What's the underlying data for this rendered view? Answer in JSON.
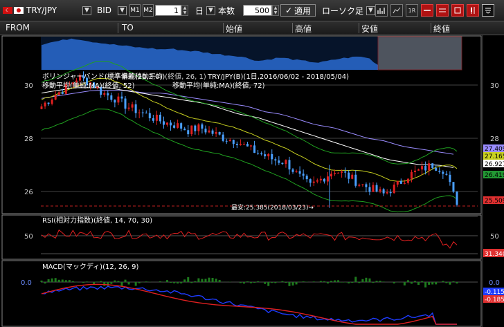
{
  "toolbar": {
    "pair": "TRY/JPY",
    "price_type": "BID",
    "period_value": "1",
    "period_unit": "日",
    "count_label": "本数",
    "count_value": "500",
    "apply_label": "適用",
    "candle_label": "ローソク足",
    "m1_label": "M1",
    "m2_label": "M2",
    "check_mark": "✓",
    "dropdown_arrow": "▼",
    "icons": [
      "bar-chart-icon",
      "line-chart-icon",
      "1r-icon",
      "red-line-icon",
      "red-band-icon",
      "red-chart-icon",
      "red-candle-icon",
      "menu-icon"
    ]
  },
  "header": {
    "columns": [
      "FROM",
      "TO",
      "始値",
      "高値",
      "安値",
      "終値"
    ]
  },
  "main": {
    "indicator_bb": "ボリンジャーバンド(標準偏差(20,2,0))",
    "overlay_label": "単純移動平均 (終値, 26, 1)",
    "title": "TRY/JPY(B)(1日,2016/06/02 - 2018/05/04)",
    "ma_labels": [
      "移動平均(単純:MA)(終値, 52)",
      "移動平均(単純:MA)(終値, 72)"
    ],
    "low_note": "最安:25.385(2018/03/23)→",
    "y_ticks": [
      "30",
      "28",
      "26"
    ],
    "right_ticks": [
      "30",
      "28",
      "26"
    ],
    "price_tags": [
      {
        "text": "27.409",
        "color": "#9a8cff"
      },
      {
        "text": "27.165",
        "color": "#c8d020"
      },
      {
        "text": "26.927",
        "color": "#ffffff"
      },
      {
        "text": "26.419",
        "color": "#229933"
      },
      {
        "text": "25.509",
        "color": "#e03030"
      }
    ]
  },
  "rsi": {
    "label": "RSI(相対力指数)(終値, 14, 70, 30)",
    "y_ticks": [
      "50"
    ],
    "right_ticks": [
      "50"
    ],
    "value_tag": "31.340"
  },
  "macd": {
    "label": "MACD(マックディ)(12, 26, 9)",
    "y_ticks": [
      "0.0"
    ],
    "right_ticks": [
      "0.0"
    ],
    "value_tags": [
      "-0.115",
      "-0.185"
    ]
  },
  "colors": {
    "up": "#e02020",
    "down": "#4aa0ff",
    "bb_band": "#20a020",
    "ma52": "#ffffff",
    "ma72": "#9a8cff",
    "ma26": "#c8d020",
    "rsi_line": "#e02020",
    "macd_line": "#1e3cff",
    "signal_line": "#e02020",
    "hist": "#1e7a1e"
  },
  "chart_data": {
    "type": "line",
    "title": "TRY/JPY(B)(1日,2016/06/02 - 2018/05/04)",
    "x_range": [
      "2016/06/02",
      "2018/05/04"
    ],
    "ylim": [
      25.2,
      30.6
    ],
    "yticks": [
      26,
      28,
      30
    ],
    "series": [
      {
        "name": "close",
        "values": [
          29.2,
          29.6,
          29.9,
          30.3,
          30.1,
          29.7,
          29.5,
          29.2,
          29.0,
          28.8,
          28.6,
          28.5,
          28.3,
          28.4,
          28.2,
          28.0,
          27.9,
          27.6,
          27.4,
          27.2,
          27.1,
          26.6,
          26.2,
          26.5,
          26.8,
          26.6,
          26.3,
          26.1,
          25.9,
          26.2,
          26.6,
          26.8,
          27.0,
          26.8,
          25.5
        ]
      },
      {
        "name": "移動平均(単純:MA)(終値, 52)",
        "values": [
          29.7,
          29.8,
          29.9,
          29.9,
          29.9,
          29.8,
          29.7,
          29.6,
          29.5,
          29.4,
          29.3,
          29.1,
          28.9,
          28.8,
          28.6,
          28.4,
          28.2,
          28.0,
          27.8,
          27.6,
          27.4,
          27.2,
          27.1,
          27.0,
          27.0,
          26.9
        ]
      },
      {
        "name": "移動平均(単純:MA)(終値, 72)",
        "values": [
          29.5,
          29.6,
          29.7,
          29.8,
          29.8,
          29.8,
          29.7,
          29.7,
          29.6,
          29.5,
          29.4,
          29.3,
          29.2,
          29.0,
          28.9,
          28.7,
          28.5,
          28.4,
          28.2,
          28.0,
          27.9,
          27.7,
          27.6,
          27.5,
          27.4
        ]
      },
      {
        "name": "最安",
        "values": [
          25.385
        ]
      }
    ],
    "rsi": {
      "overbought": 70,
      "oversold": 30,
      "last": 31.34
    },
    "macd": {
      "macd_last": -0.115,
      "signal_last": -0.185
    }
  }
}
